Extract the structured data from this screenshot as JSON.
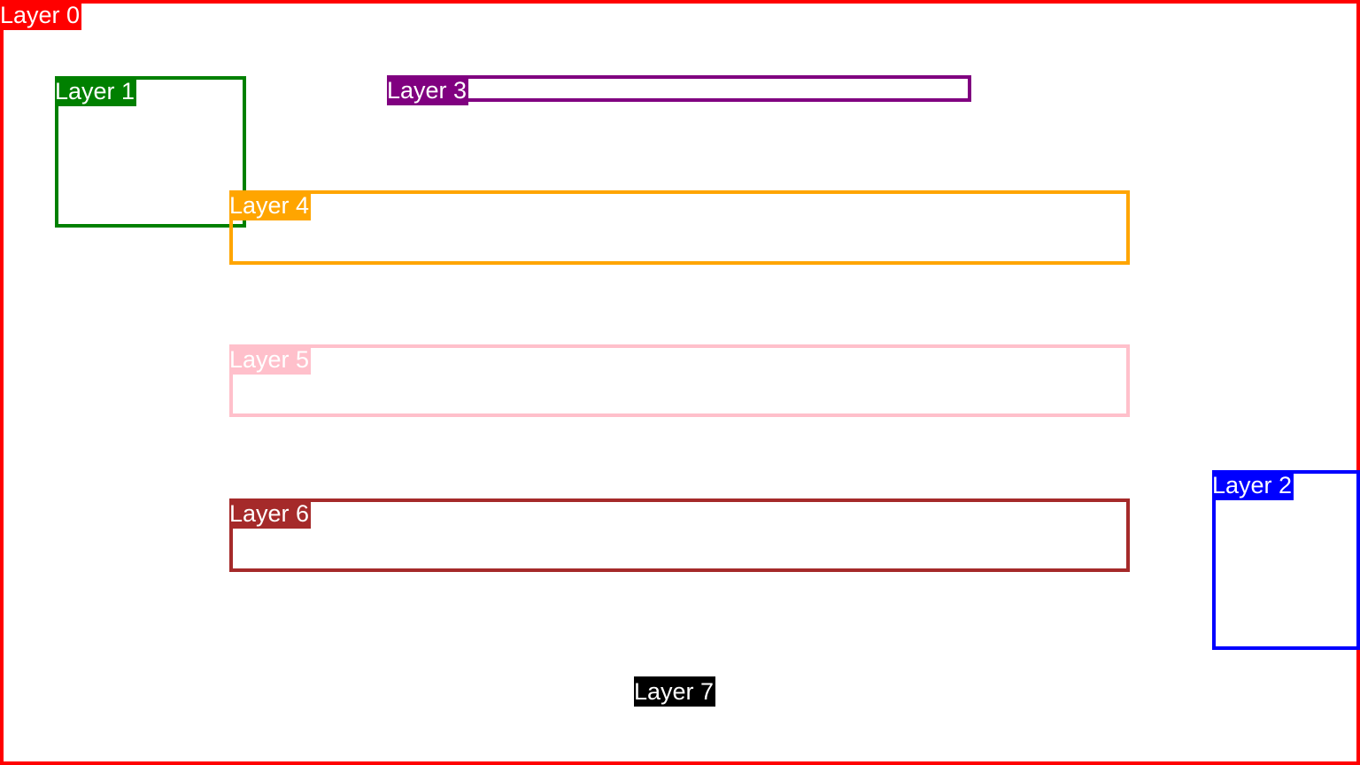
{
  "layers": [
    {
      "label": "Layer 0",
      "color": "#ff0000"
    },
    {
      "label": "Layer 1",
      "color": "#008000"
    },
    {
      "label": "Layer 2",
      "color": "#0000ff"
    },
    {
      "label": "Layer 3",
      "color": "#800080"
    },
    {
      "label": "Layer 4",
      "color": "#ffa500"
    },
    {
      "label": "Layer 5",
      "color": "#ffc0cb"
    },
    {
      "label": "Layer 6",
      "color": "#a52a2a"
    },
    {
      "label": "Layer 7",
      "color": "#000000"
    }
  ]
}
